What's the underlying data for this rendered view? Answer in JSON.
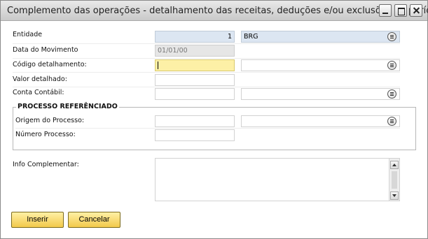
{
  "window": {
    "title": "Complemento das operações - detalhamento das receitas, deduções e/ou exclusões do período"
  },
  "form": {
    "entidade": {
      "label": "Entidade",
      "code": "1",
      "name": "BRG"
    },
    "data_movimento": {
      "label": "Data do Movimento",
      "value": "01/01/00"
    },
    "codigo_detalhamento": {
      "label": "Código detalhamento:",
      "value": "",
      "description": ""
    },
    "valor_detalhado": {
      "label": "Valor detalhado:",
      "value": ""
    },
    "conta_contabil": {
      "label": "Conta Contábil:",
      "value": "",
      "description": ""
    }
  },
  "processo": {
    "title": "PROCESSO REFERÊNCIADO",
    "origem": {
      "label": "Origem do Processo:",
      "value": "",
      "description": ""
    },
    "numero": {
      "label": "Número Processo:",
      "value": ""
    }
  },
  "info": {
    "label": "Info Complementar:",
    "value": ""
  },
  "buttons": {
    "inserir": "Inserir",
    "cancelar": "Cancelar"
  },
  "icons": {
    "lookup": "lookup-list-icon"
  },
  "colors": {
    "highlight_field": "#fdf0a6",
    "key_field": "#dce6f2",
    "readonly_field": "#e6e6e6",
    "button": "#f2c94b"
  }
}
